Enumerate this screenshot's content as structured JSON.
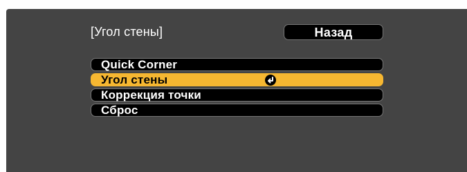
{
  "header": {
    "title": "[Угол стены]",
    "back_label": "Назад"
  },
  "menu": {
    "items": [
      {
        "label": "Quick Corner",
        "selected": false
      },
      {
        "label": "Угол стены",
        "selected": true,
        "icon": "enter-icon"
      },
      {
        "label": "Коррекция точки",
        "selected": false
      },
      {
        "label": "Сброс",
        "selected": false
      }
    ]
  },
  "colors": {
    "panel_background": "#444444",
    "item_background": "#000000",
    "selected_background": "#f6b731",
    "text": "#ffffff",
    "selected_text": "#000000"
  }
}
